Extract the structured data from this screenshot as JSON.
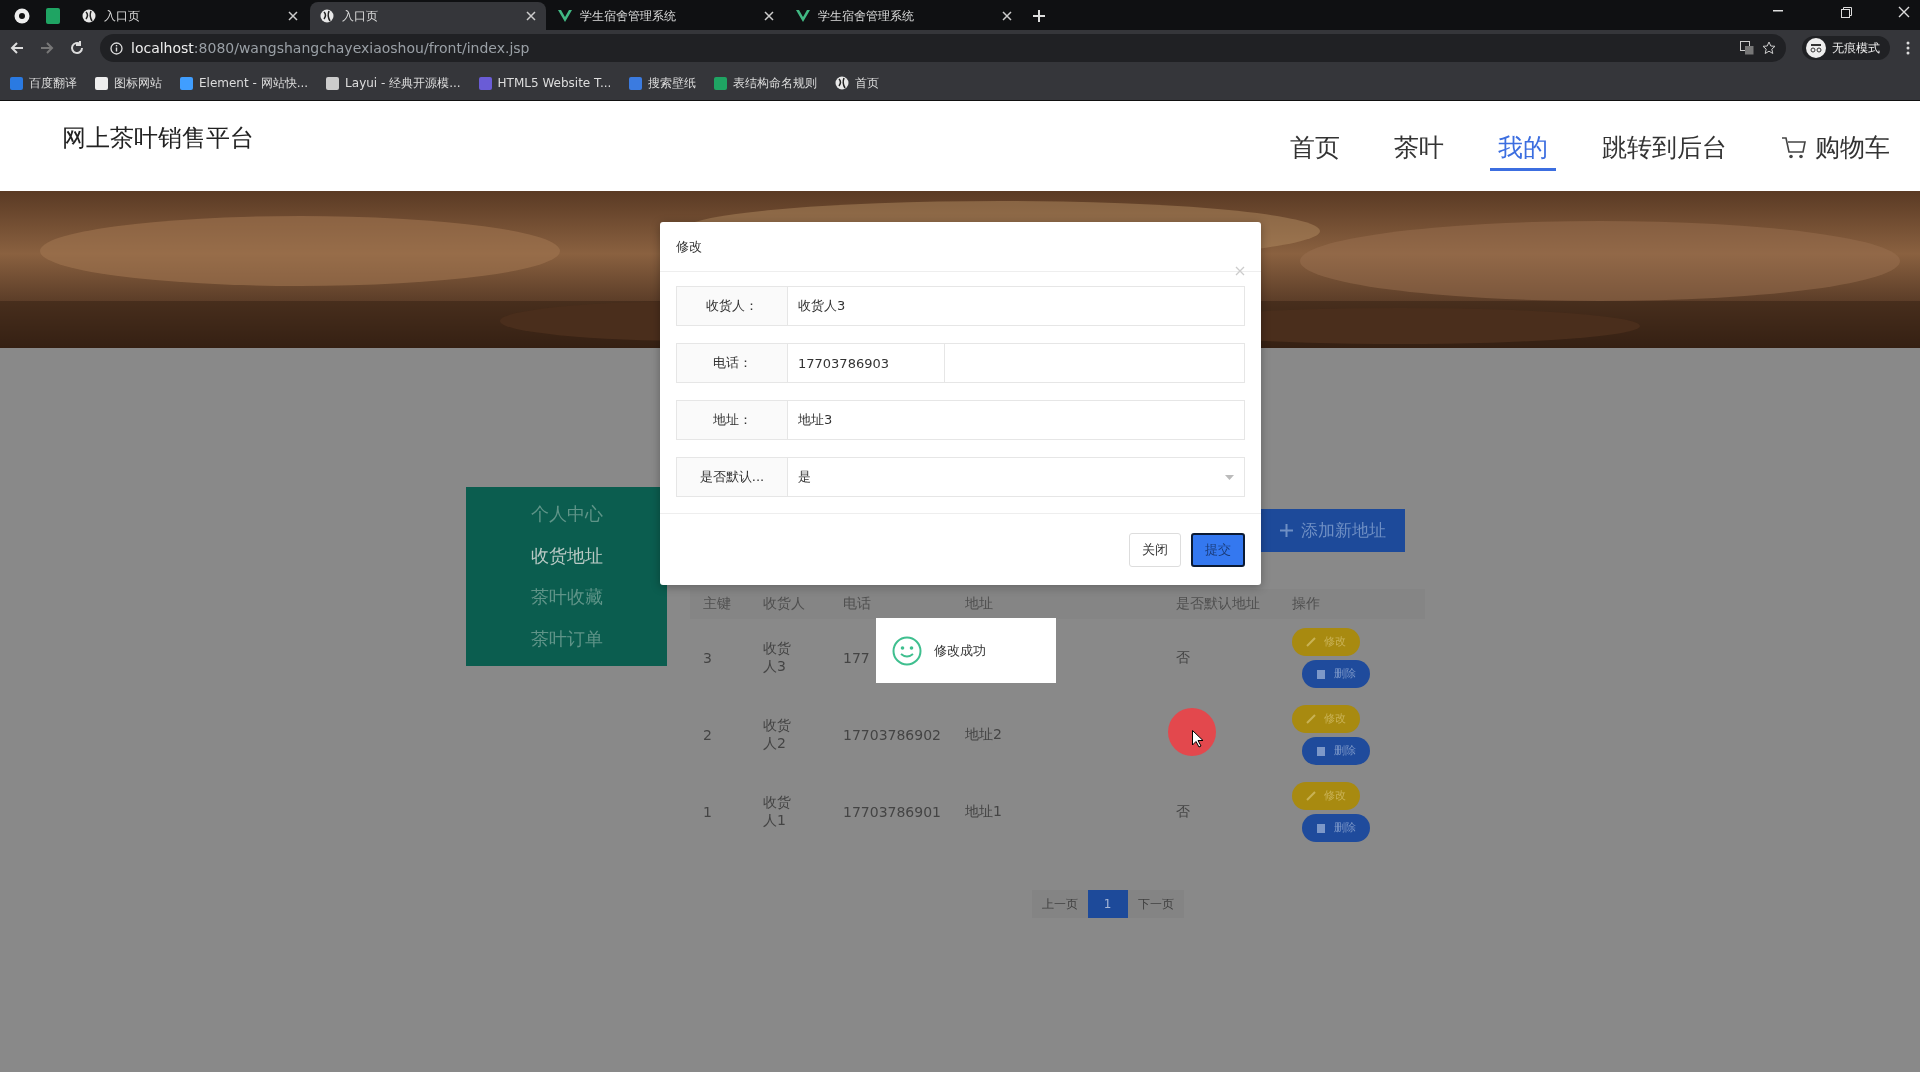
{
  "browser": {
    "tabs": [
      {
        "title": "入口页",
        "kind": "globe",
        "selected": false
      },
      {
        "title": "入口页",
        "kind": "globe",
        "selected": true
      },
      {
        "title": "学生宿舍管理系统",
        "kind": "vue",
        "selected": false
      },
      {
        "title": "学生宿舍管理系统",
        "kind": "vue",
        "selected": false
      }
    ],
    "url_host": "localhost",
    "url_path": ":8080/wangshangchayexiaoshou/front/index.jsp",
    "profile": "无痕模式",
    "bookmarks": [
      {
        "label": "百度翻译",
        "kind": "translate"
      },
      {
        "label": "图标网站",
        "kind": "flag"
      },
      {
        "label": "Element - 网站快...",
        "kind": "element"
      },
      {
        "label": "Layui - 经典开源模...",
        "kind": "layui"
      },
      {
        "label": "HTML5 Website T...",
        "kind": "html5"
      },
      {
        "label": "搜索壁纸",
        "kind": "wallpaper"
      },
      {
        "label": "表结构命名规则",
        "kind": "sheet"
      },
      {
        "label": "首页",
        "kind": "globe"
      }
    ]
  },
  "site": {
    "title": "网上茶叶销售平台",
    "nav": [
      {
        "label": "首页",
        "selected": false
      },
      {
        "label": "茶叶",
        "selected": false
      },
      {
        "label": "我的",
        "selected": true
      },
      {
        "label": "跳转到后台",
        "selected": false
      },
      {
        "label": "购物车",
        "selected": false,
        "kind": "cart"
      }
    ]
  },
  "sidebar": [
    {
      "label": "个人中心",
      "selected": false
    },
    {
      "label": "收货地址",
      "selected": true
    },
    {
      "label": "茶叶收藏",
      "selected": false
    },
    {
      "label": "茶叶订单",
      "selected": false
    }
  ],
  "add_button": "添加新地址",
  "table": {
    "columns": [
      "主键",
      "收货人",
      "电话",
      "地址",
      "是否默认地址",
      "操作"
    ],
    "rows": [
      {
        "id": "3",
        "name": "收货人3",
        "phone": "177",
        "is_default": "否",
        "edit": "修改",
        "delete": "删除"
      },
      {
        "id": "2",
        "name": "收货人2",
        "phone": "17703786902",
        "address": "地址2",
        "edit": "修改",
        "delete": "删除"
      },
      {
        "id": "1",
        "name": "收货人1",
        "phone": "17703786901",
        "address": "地址1",
        "is_default": "否",
        "edit": "修改",
        "delete": "删除"
      }
    ]
  },
  "pagination": {
    "prev": "上一页",
    "pages": [
      {
        "label": "1",
        "selected": true
      }
    ],
    "next": "下一页"
  },
  "dialog": {
    "title": "修改",
    "fields": [
      {
        "label": "收货人：",
        "value": "收货人3",
        "kind": "text"
      },
      {
        "label": "电话：",
        "value": "17703786903",
        "kind": "short"
      },
      {
        "label": "地址：",
        "value": "地址3",
        "kind": "text"
      },
      {
        "label": "是否默认...",
        "value": "是",
        "kind": "select"
      }
    ],
    "buttons": [
      {
        "label": "关闭",
        "kind": "default"
      },
      {
        "label": "提交",
        "kind": "primary"
      }
    ]
  },
  "toast": {
    "message": "修改成功"
  }
}
